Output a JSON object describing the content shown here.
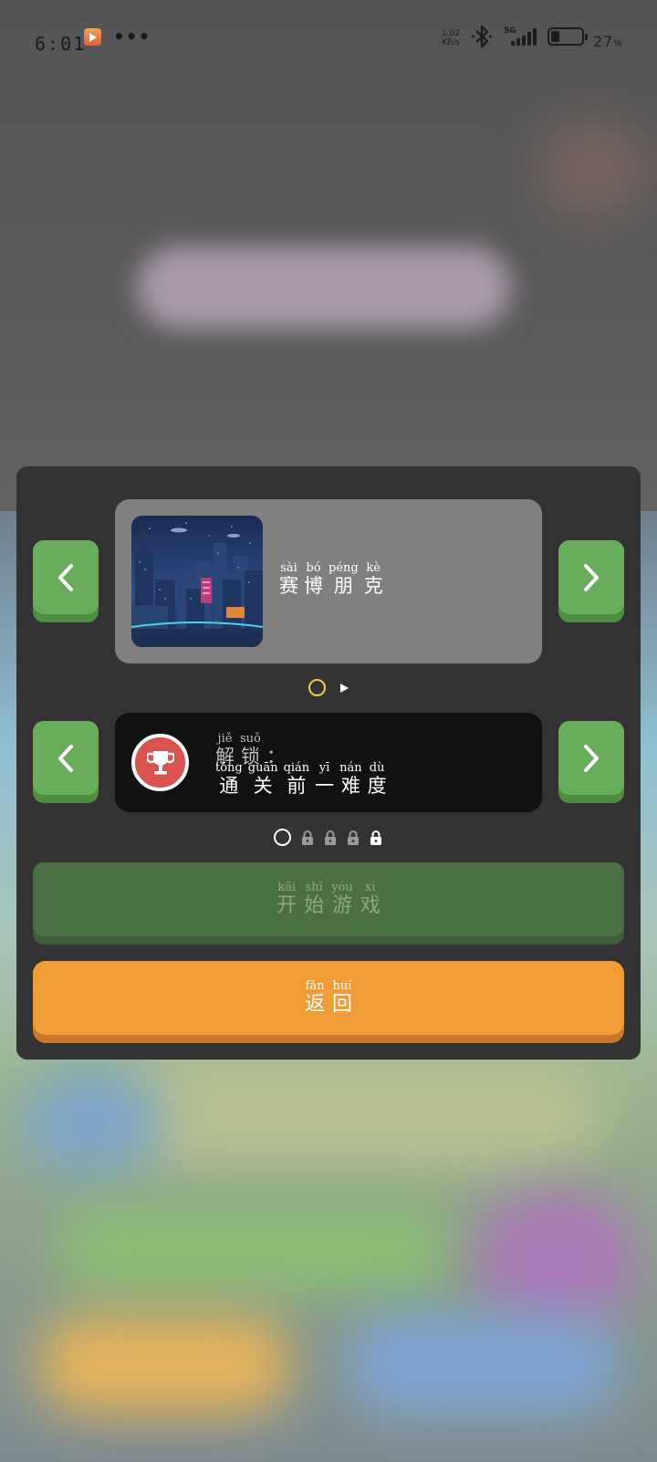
{
  "status_bar": {
    "time": "6:01",
    "more": "•••",
    "net_speed_value": "1.02",
    "net_speed_unit": "KB/s",
    "network": "5G",
    "battery_percent": "27",
    "battery_unit": "%",
    "battery_level": 0.27
  },
  "theme_card": {
    "name": [
      {
        "char": "赛",
        "pinyin": "sài"
      },
      {
        "char": "博",
        "pinyin": "bó"
      },
      {
        "char": "朋",
        "pinyin": "péng"
      },
      {
        "char": "克",
        "pinyin": "kè"
      }
    ]
  },
  "theme_pager": {
    "current": 1,
    "total": 2
  },
  "difficulty_card": {
    "unlock_label": [
      {
        "char": "解",
        "pinyin": "jiě"
      },
      {
        "char": "锁",
        "pinyin": "suǒ"
      },
      {
        "char": "：",
        "pinyin": ""
      }
    ],
    "unlock_requirement": [
      {
        "char": "通",
        "pinyin": "tōng"
      },
      {
        "char": "关",
        "pinyin": "guān"
      },
      {
        "char": "前",
        "pinyin": "qián"
      },
      {
        "char": "一",
        "pinyin": "yī"
      },
      {
        "char": "难",
        "pinyin": "nán"
      },
      {
        "char": "度",
        "pinyin": "dù"
      }
    ]
  },
  "difficulty_pager": {
    "current": 1,
    "locked_count": 4
  },
  "start_button": [
    {
      "char": "开",
      "pinyin": "kāi"
    },
    {
      "char": "始",
      "pinyin": "shǐ"
    },
    {
      "char": "游",
      "pinyin": "yóu"
    },
    {
      "char": "戏",
      "pinyin": "xì"
    }
  ],
  "back_button": [
    {
      "char": "返",
      "pinyin": "fǎn"
    },
    {
      "char": "回",
      "pinyin": "huí"
    }
  ],
  "colors": {
    "panel": "#333333",
    "nav_green": "#67ad5b",
    "start_green": "#4b7044",
    "back_orange": "#f09d37",
    "trophy_red": "#d9534f",
    "pager_active": "#f2d04b"
  }
}
